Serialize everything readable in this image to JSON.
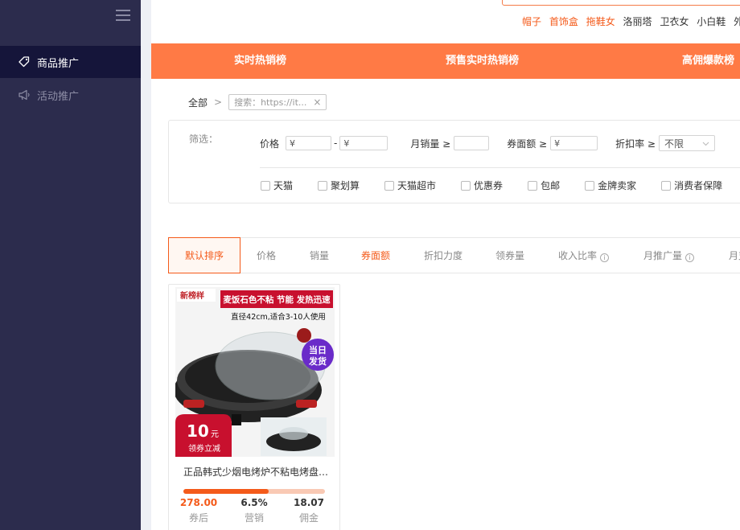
{
  "sidebar": {
    "items": [
      {
        "label": "商品推广",
        "icon": "tag-icon",
        "active": true
      },
      {
        "label": "活动推广",
        "icon": "megaphone-icon",
        "active": false
      }
    ]
  },
  "header": {
    "hot_words": [
      {
        "text": "帽子",
        "hot": true
      },
      {
        "text": "首饰盒",
        "hot": true
      },
      {
        "text": "拖鞋女",
        "hot": true
      },
      {
        "text": "洛丽塔",
        "hot": false
      },
      {
        "text": "卫衣女",
        "hot": false
      },
      {
        "text": "小白鞋",
        "hot": false
      },
      {
        "text": "外",
        "hot": false
      }
    ]
  },
  "rank_tabs": [
    "实时热销榜",
    "预售实时热销榜",
    "高佣爆款榜"
  ],
  "breadcrumb": {
    "all": "全部",
    "separator": ">",
    "chip_text": "搜索：https://it...",
    "chip_close": "×"
  },
  "filters": {
    "label": "筛选：",
    "price_label": "价格",
    "price_min_placeholder": "¥",
    "price_sep": "-",
    "price_max_placeholder": "¥",
    "monthly_sales_label": "月销量 ≥",
    "coupon_label": "券面额 ≥",
    "coupon_placeholder": "¥",
    "discount_label": "折扣率 ≥",
    "discount_value": "不限",
    "checkboxes": [
      "天猫",
      "聚划算",
      "天猫超市",
      "优惠券",
      "包邮",
      "金牌卖家",
      "消费者保障"
    ]
  },
  "sort": {
    "items": [
      {
        "label": "默认排序",
        "state": "active",
        "info": false
      },
      {
        "label": "价格",
        "state": "",
        "info": false
      },
      {
        "label": "销量",
        "state": "",
        "info": false
      },
      {
        "label": "券面额",
        "state": "hl",
        "info": false
      },
      {
        "label": "折扣力度",
        "state": "",
        "info": false
      },
      {
        "label": "领券量",
        "state": "",
        "info": false
      },
      {
        "label": "收入比率",
        "state": "",
        "info": true
      },
      {
        "label": "月推广量",
        "state": "",
        "info": true
      },
      {
        "label": "月支",
        "state": "",
        "info": false
      }
    ]
  },
  "product": {
    "image": {
      "brand": "新榜样",
      "headline": "麦饭石色不粘 节能 发热迅速",
      "size_text": "直径42cm,适合3-10人使用",
      "badge_line1": "当日",
      "badge_line2": "发货",
      "coupon_amount": "10",
      "coupon_unit": "元",
      "coupon_text": "领券立减"
    },
    "title": "正品韩式少烟电烤炉不粘电烤盘家用",
    "progress": 0.6,
    "price": "278.00",
    "price_label": "券后",
    "sales_rate": "6.5%",
    "sales_rate_label": "营销",
    "commission": "18.07",
    "commission_label": "佣金"
  },
  "colors": {
    "sidebar_bg": "#2c2c4d",
    "accent": "#ff7a45",
    "highlight": "#f45a1a"
  }
}
